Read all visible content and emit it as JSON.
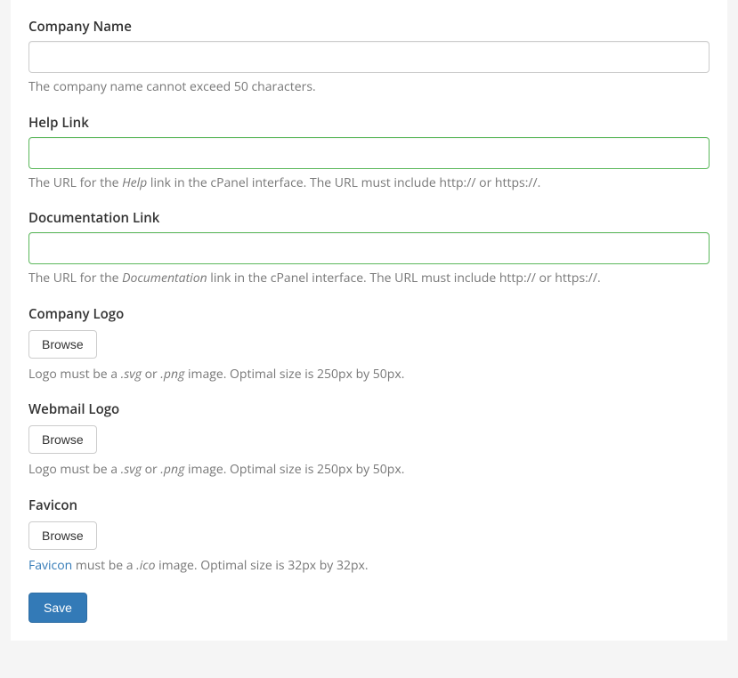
{
  "form": {
    "companyName": {
      "label": "Company Name",
      "value": "",
      "helpText": "The company name cannot exceed 50 characters."
    },
    "helpLink": {
      "label": "Help Link",
      "value": "",
      "helpPrefix": "The URL for the ",
      "helpEm": "Help",
      "helpSuffix": " link in the cPanel interface. The URL must include http:// or https://."
    },
    "documentationLink": {
      "label": "Documentation Link",
      "value": "",
      "helpPrefix": "The URL for the ",
      "helpEm": "Documentation",
      "helpSuffix": " link in the cPanel interface. The URL must include http:// or https://."
    },
    "companyLogo": {
      "label": "Company Logo",
      "browseLabel": "Browse",
      "helpPrefix": "Logo must be a ",
      "helpEm1": ".svg",
      "helpMid": " or ",
      "helpEm2": ".png",
      "helpSuffix": " image. Optimal size is 250px by 50px."
    },
    "webmailLogo": {
      "label": "Webmail Logo",
      "browseLabel": "Browse",
      "helpPrefix": "Logo must be a ",
      "helpEm1": ".svg",
      "helpMid": " or ",
      "helpEm2": ".png",
      "helpSuffix": " image. Optimal size is 250px by 50px."
    },
    "favicon": {
      "label": "Favicon",
      "browseLabel": "Browse",
      "helpLinkText": "Favicon",
      "helpMid": " must be a ",
      "helpEm": ".ico",
      "helpSuffix": " image. Optimal size is 32px by 32px."
    },
    "saveLabel": "Save"
  }
}
